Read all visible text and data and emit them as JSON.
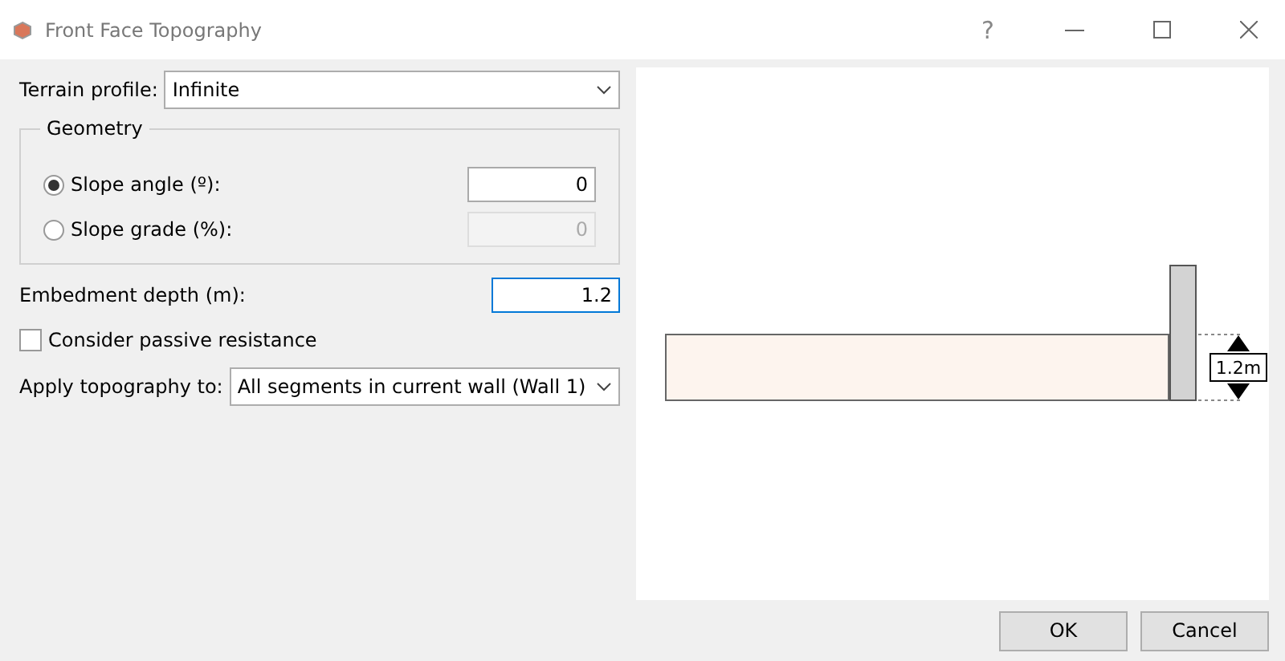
{
  "window": {
    "title": "Front Face Topography",
    "controls": [
      "?"
    ]
  },
  "terrain_profile": {
    "label": "Terrain profile:",
    "value": "Infinite"
  },
  "geometry": {
    "title": "Geometry",
    "options": [
      {
        "label": "Slope angle (º):",
        "selected": true,
        "value": "0",
        "disabled": false
      },
      {
        "label": "Slope grade (%):",
        "selected": false,
        "value": "0",
        "disabled": true
      }
    ]
  },
  "embedment": {
    "label": "Embedment depth (m):",
    "value": "1.2",
    "focused": true
  },
  "passive": {
    "label": "Consider passive resistance",
    "checked": false
  },
  "apply_to": {
    "label": "Apply topography to:",
    "value": "All segments in current wall (Wall 1)"
  },
  "preview": {
    "dimension_label": "1.2m"
  },
  "buttons": [
    "OK",
    "Cancel"
  ]
}
